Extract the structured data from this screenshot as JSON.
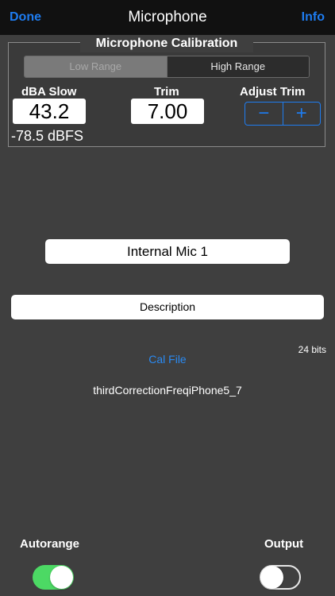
{
  "nav": {
    "left": "Done",
    "title": "Microphone",
    "right": "Info"
  },
  "calibration": {
    "title": "Microphone Calibration",
    "segments": [
      "Low Range",
      "High Range"
    ],
    "selected_segment": "High Range",
    "dba_label": "dBA Slow",
    "dba_value": "43.2",
    "dbfs_value": "-78.5 dBFS",
    "trim_label": "Trim",
    "trim_value": "7.00",
    "adjust_label": "Adjust Trim",
    "minus": "−",
    "plus": "+"
  },
  "mic": {
    "name": "Internal Mic 1",
    "description": "Description"
  },
  "bits": "24 bits",
  "cal_file": {
    "label": "Cal File",
    "name": "thirdCorrectionFreqiPhone5_7"
  },
  "switches": {
    "autorange": {
      "label": "Autorange",
      "on": true
    },
    "output": {
      "label": "Output",
      "on": false
    }
  },
  "colors": {
    "accent": "#1e7cf0",
    "switch_on": "#4cd964",
    "background": "#3f3f3f"
  }
}
